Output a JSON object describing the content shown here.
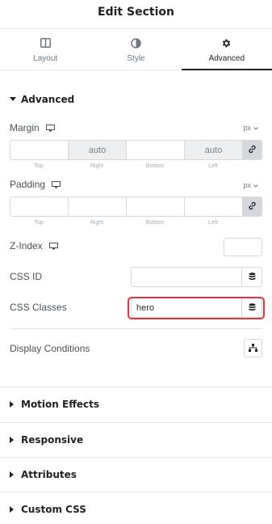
{
  "header": {
    "title": "Edit Section"
  },
  "tabs": [
    {
      "label": "Layout",
      "icon": "layout-icon"
    },
    {
      "label": "Style",
      "icon": "style-icon"
    },
    {
      "label": "Advanced",
      "icon": "gear-icon",
      "active": true
    }
  ],
  "advanced": {
    "title": "Advanced",
    "margin": {
      "label": "Margin",
      "unit": "px",
      "fields": [
        {
          "label": "Top",
          "value": ""
        },
        {
          "label": "Right",
          "value": "auto"
        },
        {
          "label": "Bottom",
          "value": ""
        },
        {
          "label": "Left",
          "value": "auto"
        }
      ]
    },
    "padding": {
      "label": "Padding",
      "unit": "px",
      "fields": [
        {
          "label": "Top",
          "value": ""
        },
        {
          "label": "Right",
          "value": ""
        },
        {
          "label": "Bottom",
          "value": ""
        },
        {
          "label": "Left",
          "value": ""
        }
      ]
    },
    "z_index": {
      "label": "Z-Index",
      "value": ""
    },
    "css_id": {
      "label": "CSS ID",
      "value": ""
    },
    "css_classes": {
      "label": "CSS Classes",
      "value": "hero"
    },
    "display_conditions": {
      "label": "Display Conditions"
    }
  },
  "collapsed_sections": [
    {
      "title": "Motion Effects"
    },
    {
      "title": "Responsive"
    },
    {
      "title": "Attributes"
    },
    {
      "title": "Custom CSS"
    }
  ],
  "colors": {
    "highlight": "#e0353c",
    "text_dark": "#1f2124",
    "text_muted": "#6d7882",
    "border": "#d5d8dc"
  }
}
